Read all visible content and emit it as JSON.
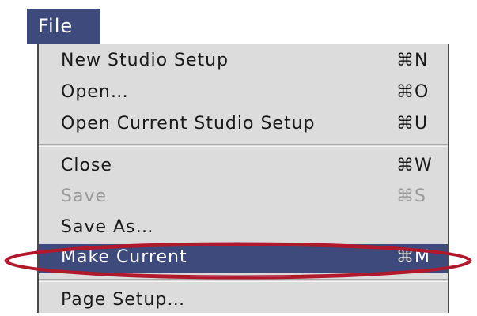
{
  "menu": {
    "title": "File",
    "items": [
      {
        "label": "New Studio Setup",
        "shortcut": "⌘N"
      },
      {
        "label": "Open…",
        "shortcut": "⌘O"
      },
      {
        "label": "Open Current Studio Setup",
        "shortcut": "⌘U"
      },
      {
        "label": "Close",
        "shortcut": "⌘W"
      },
      {
        "label": "Save",
        "shortcut": "⌘S",
        "disabled": true
      },
      {
        "label": "Save As…",
        "shortcut": ""
      },
      {
        "label": "Make Current",
        "shortcut": "⌘M",
        "highlighted": true
      },
      {
        "label": "Page Setup…",
        "shortcut": ""
      }
    ]
  },
  "colors": {
    "highlight": "#3e4a7c",
    "menu_background": "#dcdcdc",
    "disabled_text": "#9a9a9a",
    "annotation": "#b0182c"
  }
}
